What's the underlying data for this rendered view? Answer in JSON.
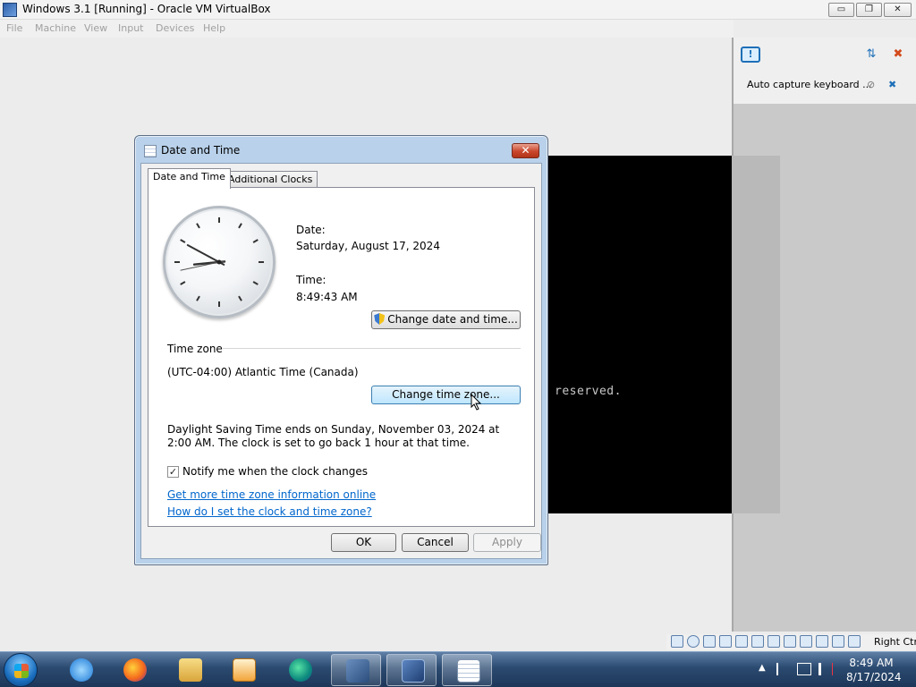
{
  "host_window": {
    "title": "Windows 3.1 [Running] - Oracle VM VirtualBox",
    "minimize": "▭",
    "restore": "❐",
    "close": "✕"
  },
  "menubar": {
    "items": [
      "File",
      "Machine",
      "View",
      "Input",
      "Devices",
      "Help"
    ]
  },
  "vm_screen": {
    "text": "reserved."
  },
  "side_panel": {
    "message": "Auto capture keyboard ...",
    "notif_icon_glyph": "!"
  },
  "dialog": {
    "title": "Date and Time",
    "close_glyph": "✕",
    "tabs": [
      "Date and Time",
      "Additional Clocks"
    ],
    "date_label": "Date:",
    "date_value": "Saturday, August 17, 2024",
    "time_label": "Time:",
    "time_value": "8:49:43 AM",
    "clock_time": {
      "hour": 8,
      "minute": 49,
      "second": 43
    },
    "change_date_button": "Change date and time...",
    "timezone_section": "Time zone",
    "timezone_value": "(UTC-04:00) Atlantic Time (Canada)",
    "change_timezone_button": "Change time zone...",
    "dst_text": "Daylight Saving Time ends on Sunday, November 03, 2024 at 2:00 AM. The clock is set to go back 1 hour at that time.",
    "notify_checkbox": "Notify me when the clock changes",
    "notify_checked": true,
    "check_glyph": "✓",
    "link_more_info": "Get more time zone information online",
    "link_how_to": "How do I set the clock and time zone?",
    "ok_button": "OK",
    "cancel_button": "Cancel",
    "apply_button": "Apply"
  },
  "vbox_status": {
    "host_key": "Right Ctrl"
  },
  "taskbar": {
    "apps": [
      "Internet Explorer",
      "Firefox",
      "Windows Explorer",
      "Media Player",
      "Edge",
      "VirtualBox",
      "Windows 3.1",
      "Date and Time"
    ],
    "tray_time": "8:49 AM",
    "tray_date": "8/17/2024",
    "colors": {
      "accent": "#3c7fb1",
      "link": "#0066cc"
    }
  }
}
